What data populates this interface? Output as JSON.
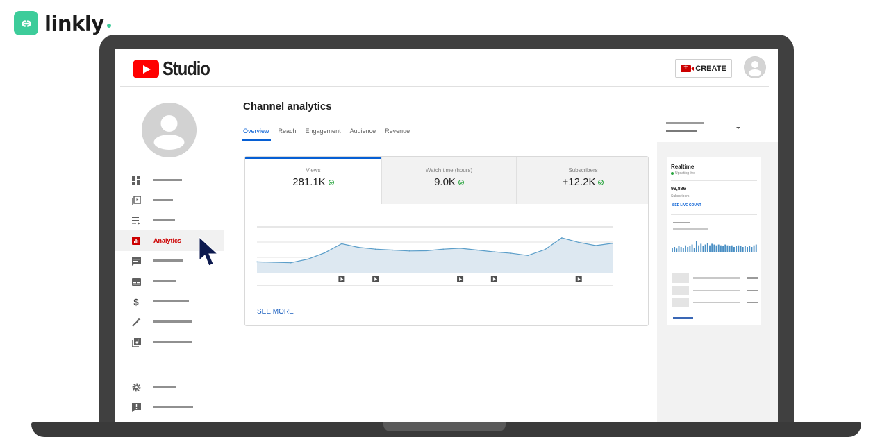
{
  "brand": {
    "name": "linkly",
    "logo_icon": "link-icon",
    "accent": "#3dcc9a"
  },
  "studio": {
    "product_name": "Studio",
    "create_label": "CREATE",
    "brand_color": "#ff0000"
  },
  "sidebar": {
    "items": [
      {
        "icon": "dashboard-icon",
        "label": ""
      },
      {
        "icon": "content-icon",
        "label": ""
      },
      {
        "icon": "playlists-icon",
        "label": ""
      },
      {
        "icon": "analytics-icon",
        "label": "Analytics",
        "active": true
      },
      {
        "icon": "comments-icon",
        "label": ""
      },
      {
        "icon": "subtitles-icon",
        "label": ""
      },
      {
        "icon": "monetization-icon",
        "label": ""
      },
      {
        "icon": "customization-icon",
        "label": ""
      },
      {
        "icon": "audio-library-icon",
        "label": ""
      },
      {
        "icon": "settings-icon",
        "label": ""
      },
      {
        "icon": "feedback-icon",
        "label": ""
      }
    ]
  },
  "main": {
    "title": "Channel analytics",
    "tabs": [
      {
        "label": "Overview",
        "active": true
      },
      {
        "label": "Reach"
      },
      {
        "label": "Engagement"
      },
      {
        "label": "Audience"
      },
      {
        "label": "Revenue"
      }
    ],
    "metrics": [
      {
        "label": "Views",
        "value": "281.1K"
      },
      {
        "label": "Watch time (hours)",
        "value": "9.0K"
      },
      {
        "label": "Subscribers",
        "value": "+12.2K"
      }
    ],
    "see_more": "SEE MORE",
    "accent": "#065fd4"
  },
  "chart_data": {
    "type": "area",
    "x": [
      0,
      1,
      2,
      3,
      4,
      5,
      6,
      7,
      8,
      9,
      10,
      11,
      12,
      13,
      14,
      15,
      16,
      17,
      18,
      19,
      20,
      21
    ],
    "series": [
      {
        "values": [
          24,
          23,
          22,
          30,
          44,
          64,
          56,
          52,
          50,
          48,
          48.5,
          52,
          54,
          50,
          46,
          43,
          38,
          51,
          77,
          67,
          60,
          65
        ]
      }
    ],
    "video_markers": [
      5,
      7,
      12,
      14,
      19
    ],
    "ylim": [
      0,
      100
    ],
    "grid": true,
    "color": "#5b9ec9",
    "fill": "#dde8f1"
  },
  "realtime": {
    "title": "Realtime",
    "status": "Updating live",
    "count": "99,886",
    "count_label": "Subscribers",
    "link": "SEE LIVE COUNT",
    "bars": [
      6,
      7,
      5,
      8,
      7,
      6,
      9,
      7,
      8,
      10,
      6,
      14,
      9,
      11,
      8,
      10,
      12,
      9,
      11,
      10,
      9,
      10,
      9,
      8,
      10,
      9,
      8,
      9,
      7,
      8,
      9,
      8,
      7,
      8,
      7,
      8,
      7,
      9,
      10
    ]
  }
}
